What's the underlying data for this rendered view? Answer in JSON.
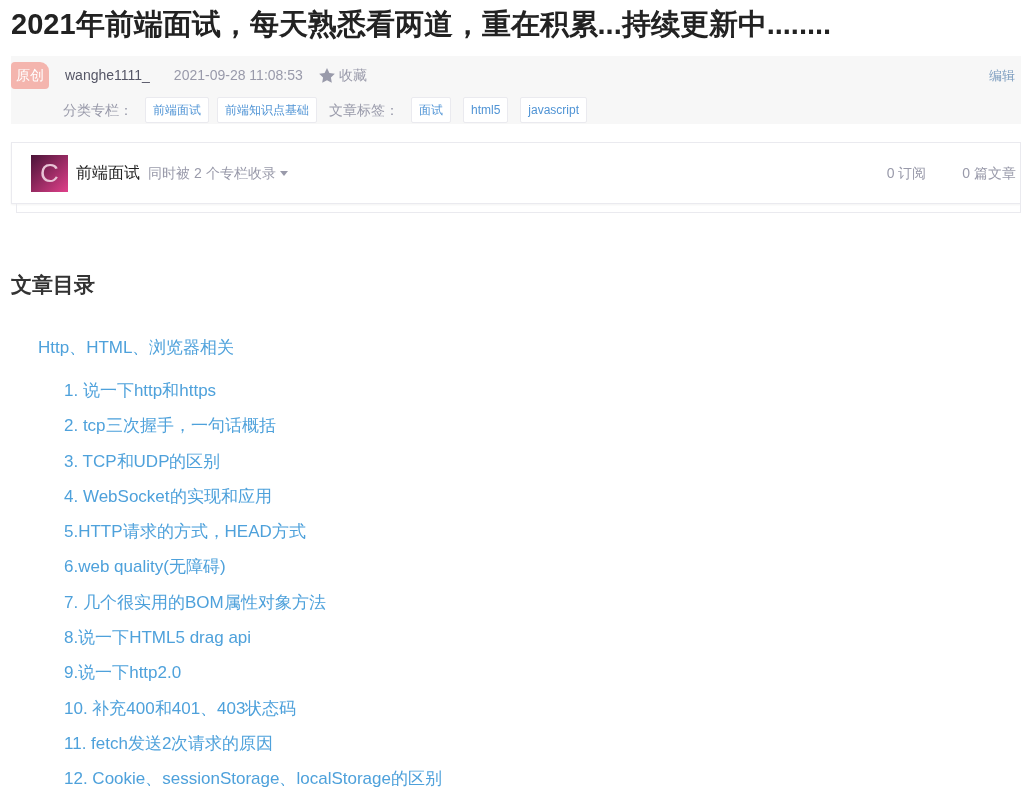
{
  "title": "2021年前端面试，每天熟悉看两道，重在积累...持续更新中........",
  "meta": {
    "badge": "原创",
    "author": "wanghe1111_",
    "time": "2021-09-28 11:08:53",
    "favorite": "收藏",
    "edit": "编辑",
    "category_label": "分类专栏：",
    "categories": [
      "前端面试",
      "前端知识点基础"
    ],
    "tag_label": "文章标签：",
    "tags": [
      "面试",
      "html5",
      "javascript"
    ]
  },
  "column": {
    "avatar_letter": "C",
    "name": "前端面试",
    "also": "同时被 2 个专栏收录",
    "subscribers": "0 订阅",
    "articles": "0 篇文章"
  },
  "toc": {
    "heading": "文章目录",
    "items": [
      {
        "text": "Http、HTML、浏览器相关",
        "children": [
          {
            "text": "1. 说一下http和https"
          },
          {
            "text": "2. tcp三次握手，一句话概括"
          },
          {
            "text": "3. TCP和UDP的区别"
          },
          {
            "text": "4. WebSocket的实现和应用"
          },
          {
            "text": "5.HTTP请求的方式，HEAD方式"
          },
          {
            "text": "6.web quality(无障碍)"
          },
          {
            "text": "7. 几个很实用的BOM属性对象方法"
          },
          {
            "text": "8.说一下HTML5 drag api"
          },
          {
            "text": "9.说一下http2.0"
          },
          {
            "text": "10. 补充400和401、403状态码"
          },
          {
            "text": "11. fetch发送2次请求的原因"
          },
          {
            "text": "12. Cookie、sessionStorage、localStorage的区别"
          }
        ]
      }
    ]
  }
}
